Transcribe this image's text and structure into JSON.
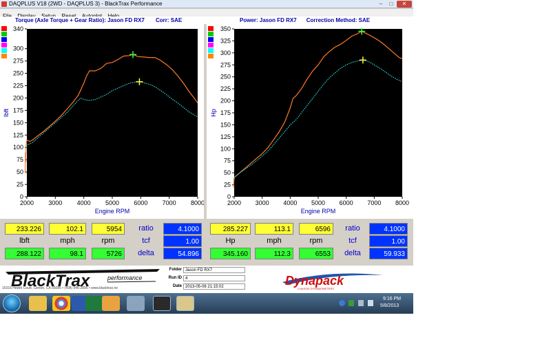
{
  "window": {
    "title": "DAQPLUS V18 (2WD - DAQPLUS 3) - BlackTrax Performance",
    "minimize": "–",
    "maximize": "□",
    "close": "✕"
  },
  "menu": [
    "File",
    "Display",
    "Setup",
    "Reset",
    "Autoplot",
    "Help"
  ],
  "left_chart": {
    "header_a": "Torque (Axle Torque + Gear Ratio): Jason FD RX7",
    "header_b": "Corr: SAE"
  },
  "right_chart": {
    "header_a": "Power: Jason FD RX7",
    "header_b": "Correction Method: SAE"
  },
  "series_colors": [
    "#ff0000",
    "#00cc00",
    "#0000ff",
    "#ff00ff",
    "#00ffff",
    "#ff8800"
  ],
  "colors": {
    "orange_trace": "#ff7a2a",
    "cyan_trace": "#33dddd",
    "marker_green": "#44ff44",
    "marker_yellow": "#ffff44"
  },
  "chart_data": [
    {
      "type": "line",
      "title": "Torque (Axle Torque + Gear Ratio): Jason FD RX7",
      "xlabel": "Engine RPM",
      "ylabel": "lbft",
      "xlim": [
        2000,
        8000
      ],
      "ylim": [
        0,
        340
      ],
      "xticks": [
        2000,
        3000,
        4000,
        5000,
        6000,
        7000,
        8000
      ],
      "yticks": [
        0,
        25,
        50,
        75,
        100,
        125,
        150,
        175,
        200,
        225,
        250,
        275,
        300,
        340
      ],
      "series": [
        {
          "color": "#ff7a2a",
          "style": "solid",
          "x": [
            1940,
            1950,
            1960,
            1970,
            1980,
            2000,
            2100,
            2200,
            2400,
            2600,
            2800,
            3000,
            3200,
            3400,
            3600,
            3800,
            4000,
            4100,
            4200,
            4400,
            4600,
            4800,
            5000,
            5200,
            5400,
            5600,
            5727,
            5900,
            6100,
            6300,
            6500,
            6700,
            6900,
            7100,
            7300,
            7500,
            7700,
            7900,
            8000
          ],
          "y": [
            50,
            90,
            70,
            100,
            110,
            115,
            112,
            115,
            124,
            133,
            143,
            153,
            164,
            177,
            190,
            205,
            230,
            245,
            255,
            255,
            260,
            270,
            272,
            278,
            285,
            286,
            288,
            284,
            283,
            282,
            282,
            276,
            268,
            258,
            245,
            230,
            213,
            198,
            190
          ]
        },
        {
          "color": "#33dddd",
          "style": "dotted",
          "x": [
            1980,
            2000,
            2100,
            2200,
            2400,
            2600,
            2800,
            3000,
            3200,
            3400,
            3600,
            3800,
            3900,
            4000,
            4200,
            4400,
            4600,
            4800,
            5000,
            5200,
            5400,
            5600,
            5800,
            5954,
            6100,
            6300,
            6500,
            6700,
            6900,
            7100,
            7300,
            7500,
            7700,
            7900,
            8000
          ],
          "y": [
            100,
            105,
            107,
            110,
            120,
            130,
            140,
            150,
            160,
            170,
            183,
            195,
            200,
            197,
            195,
            197,
            202,
            207,
            215,
            220,
            225,
            230,
            232,
            233,
            231,
            228,
            223,
            215,
            207,
            198,
            190,
            181,
            172,
            165,
            162
          ]
        }
      ],
      "markers": [
        {
          "x": 5726,
          "y": 288,
          "color": "#44ff44"
        },
        {
          "x": 5954,
          "y": 233,
          "color": "#ffff44"
        }
      ]
    },
    {
      "type": "line",
      "title": "Power: Jason FD RX7",
      "xlabel": "Engine RPM",
      "ylabel": "Hp",
      "xlim": [
        2000,
        8000
      ],
      "ylim": [
        0,
        350
      ],
      "xticks": [
        2000,
        3000,
        4000,
        5000,
        6000,
        7000,
        8000
      ],
      "yticks": [
        0,
        25,
        50,
        75,
        100,
        125,
        150,
        175,
        200,
        225,
        250,
        275,
        300,
        325,
        350
      ],
      "series": [
        {
          "color": "#ff7a2a",
          "style": "solid",
          "x": [
            1960,
            1980,
            2000,
            2200,
            2400,
            2600,
            2800,
            3000,
            3200,
            3400,
            3600,
            3800,
            4000,
            4100,
            4200,
            4400,
            4600,
            4800,
            5000,
            5200,
            5400,
            5600,
            5800,
            6000,
            6200,
            6400,
            6553,
            6700,
            6900,
            7100,
            7300,
            7500,
            7700,
            7900,
            8000
          ],
          "y": [
            20,
            25,
            40,
            50,
            60,
            70,
            80,
            90,
            102,
            118,
            135,
            155,
            185,
            205,
            210,
            225,
            245,
            262,
            275,
            292,
            303,
            312,
            318,
            326,
            335,
            340,
            345,
            341,
            335,
            328,
            320,
            310,
            300,
            290,
            288
          ]
        },
        {
          "color": "#33dddd",
          "style": "dotted",
          "x": [
            1990,
            2000,
            2200,
            2400,
            2600,
            2800,
            3000,
            3200,
            3400,
            3600,
            3800,
            4000,
            4200,
            4400,
            4600,
            4800,
            5000,
            5200,
            5400,
            5600,
            5800,
            6000,
            6200,
            6400,
            6596,
            6800,
            7000,
            7200,
            7400,
            7600,
            7800,
            8000
          ],
          "y": [
            35,
            40,
            50,
            58,
            66,
            75,
            85,
            95,
            108,
            122,
            135,
            150,
            160,
            175,
            190,
            205,
            220,
            235,
            248,
            258,
            268,
            275,
            280,
            283,
            285,
            282,
            275,
            268,
            260,
            252,
            245,
            240
          ]
        }
      ],
      "markers": [
        {
          "x": 6553,
          "y": 345,
          "color": "#44ff44"
        },
        {
          "x": 6596,
          "y": 285,
          "color": "#ffff44"
        }
      ]
    }
  ],
  "readouts": {
    "left": {
      "row1": [
        "233.226",
        "102.1",
        "5954"
      ],
      "labels": [
        "lbft",
        "mph",
        "rpm"
      ],
      "row3": [
        "288.122",
        "98.1",
        "5726"
      ],
      "ratio_label": "ratio",
      "ratio_value": "4.1000",
      "tcf_label": "tcf",
      "tcf_value": "1.00",
      "delta_label": "delta",
      "delta_value": "54.896"
    },
    "right": {
      "row1": [
        "285.227",
        "113.1",
        "6596"
      ],
      "labels": [
        "Hp",
        "mph",
        "rpm"
      ],
      "row3": [
        "345.160",
        "112.3",
        "6553"
      ],
      "ratio_label": "ratio",
      "ratio_value": "4.1000",
      "tcf_label": "tcf",
      "tcf_value": "1.00",
      "delta_label": "delta",
      "delta_value": "59.933"
    }
  },
  "info": {
    "folder_label": "Folder",
    "folder_value": "Jason FD RX7",
    "run_label": "Run ID",
    "run_value": "4",
    "date_label": "Date",
    "date_value": "2013-05-08 21:15:02"
  },
  "logos": {
    "blacktrax": "BlackTrax",
    "blacktrax_sub": "performance",
    "blacktrax_address": "15316 Hewitt Court, Clinton, CA 55085 • (408) 946-2895 • www.blacktrax.ne",
    "dynapack": "Dynapack",
    "dynapack_sub": "CHASSIS DYNAMOMETERS"
  },
  "taskbar": {
    "time": "9:16 PM",
    "date": "5/8/2013"
  }
}
